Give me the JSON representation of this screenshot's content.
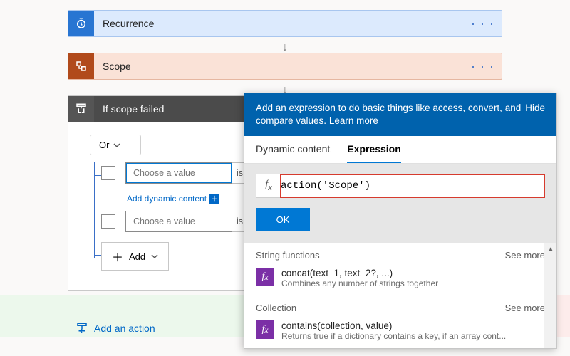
{
  "cards": {
    "recurrence": {
      "title": "Recurrence"
    },
    "scope": {
      "title": "Scope"
    },
    "ifScopeFailed": {
      "title": "If scope failed"
    }
  },
  "condition": {
    "groupType": "Or",
    "rows": [
      {
        "placeholder": "Choose a value",
        "operator": "is eq"
      },
      {
        "placeholder": "Choose a value",
        "operator": "is eq"
      }
    ],
    "dynamicLink": "Add dynamic content",
    "addBtn": "Add"
  },
  "addActionLabel": "Add an action",
  "popover": {
    "banner": "Add an expression to do basic things like access, convert, and compare values.",
    "learnMore": "Learn more",
    "hide": "Hide",
    "tabs": {
      "dynamic": "Dynamic content",
      "expression": "Expression"
    },
    "expressionValue": "action('Scope')",
    "ok": "OK",
    "sections": [
      {
        "title": "String functions",
        "seeMore": "See more",
        "items": [
          {
            "sig": "concat(text_1, text_2?, ...)",
            "desc": "Combines any number of strings together"
          }
        ]
      },
      {
        "title": "Collection",
        "seeMore": "See more",
        "items": [
          {
            "sig": "contains(collection, value)",
            "desc": "Returns true if a dictionary contains a key, if an array cont..."
          }
        ]
      }
    ]
  }
}
